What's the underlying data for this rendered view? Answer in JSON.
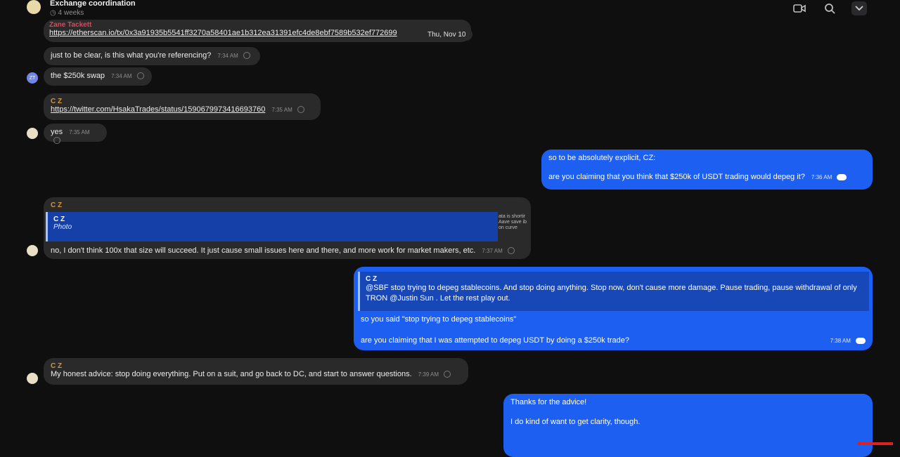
{
  "header": {
    "title": "Exchange coordination",
    "subtitle": "◷ 4 weeks",
    "icons": [
      "video-call-icon",
      "search-icon",
      "chevron-down-icon"
    ]
  },
  "date_pill": "Thu, Nov 10",
  "messages": [
    {
      "sender": "Zane Tackett",
      "text": "https://etherscan.io/tx/0x3a91935b5541ff3270a58401ae1b312ea31391efc4de8ebf7589b532ef772699",
      "time": ""
    },
    {
      "text": "just to be clear, is this what you're referencing?",
      "time": "7:34 AM"
    },
    {
      "text": "the $250k swap",
      "time": "7:34 AM"
    },
    {
      "sender": "C Z",
      "text": "https://twitter.com/HsakaTrades/status/1590679973416693760",
      "time": "7:35 AM"
    },
    {
      "text": "yes",
      "time": "7:35 AM"
    },
    {
      "line1": "so to be absolutely explicit, CZ:",
      "line2": "are you claiming that you think that $250k of USDT trading would depeg it?",
      "time": "7:36 AM"
    },
    {
      "sender": "C Z",
      "quote_name": "C Z",
      "quote_sub": "Photo",
      "quote_fragment": "ata is shortir Aave save ib on curve",
      "text": "no, I don't think 100x that size will succeed. It just cause small issues here and there, and more work for market makers, etc.",
      "time": "7:37 AM"
    },
    {
      "quote_name": "C Z",
      "quote_text": "@SBF  stop trying to depeg stablecoins. And stop doing anything. Stop now, don't cause more damage. Pause trading, pause withdrawal of only TRON @Justin Sun . Let the rest play out.",
      "line1": "so you said \"stop trying to depeg stablecoins\"",
      "line2": "are you claiming that I was attempted to depeg USDT by doing a $250k trade?",
      "time": "7:38 AM"
    },
    {
      "sender": "C Z",
      "text": "My honest advice: stop doing everything. Put on a suit, and go back to DC, and start to answer questions.",
      "time": "7:39 AM"
    },
    {
      "line1": "Thanks for the advice!",
      "line2": "I do kind of want to get clarity, though."
    }
  ]
}
